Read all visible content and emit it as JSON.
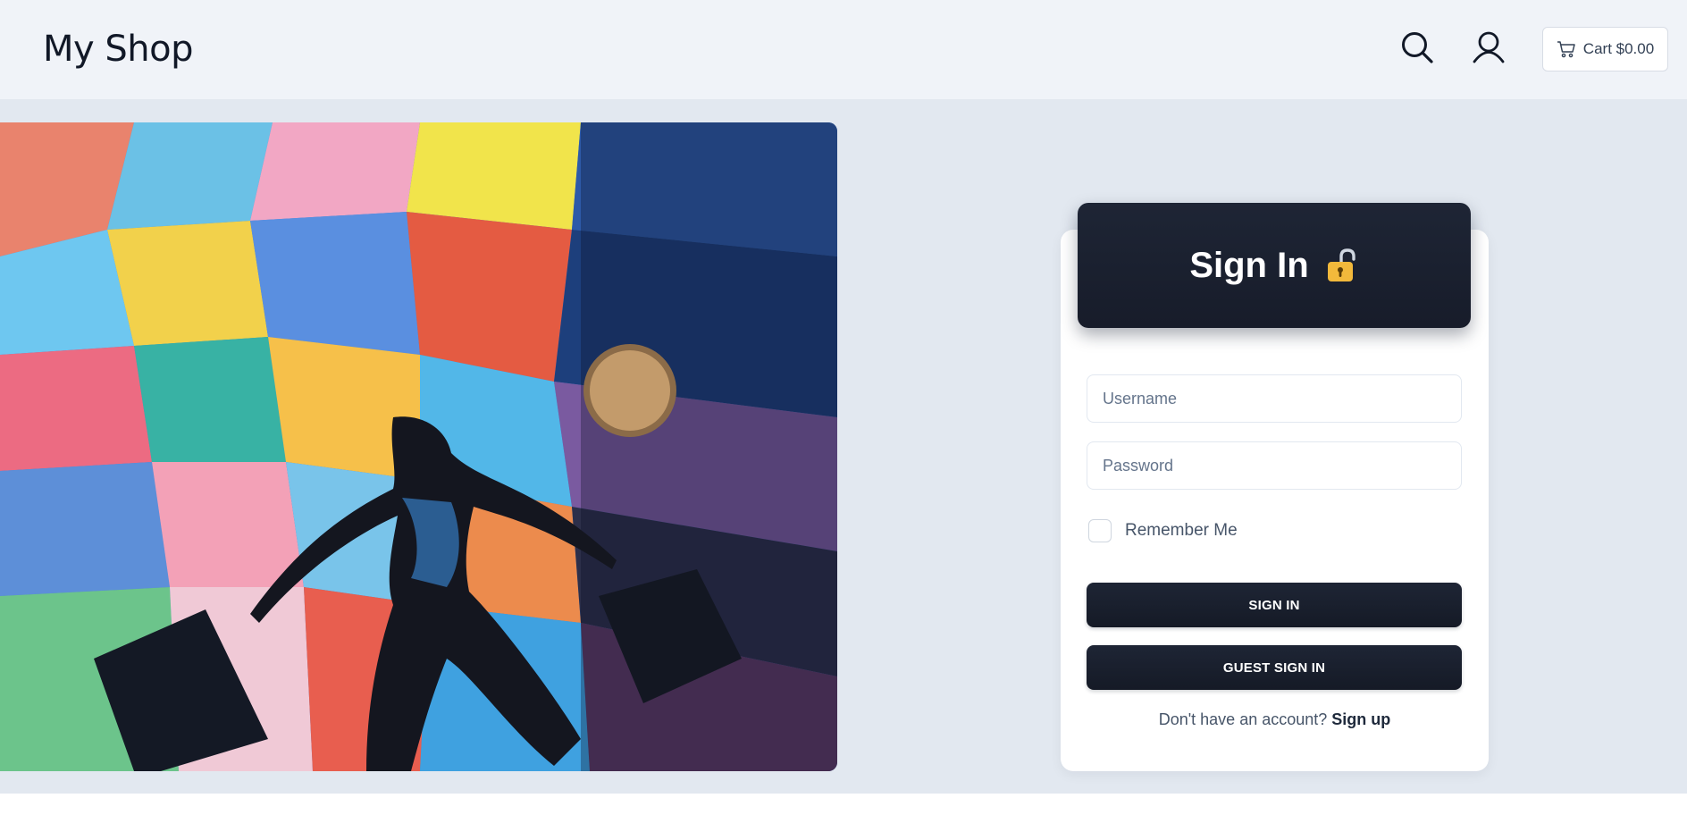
{
  "header": {
    "brand": "My Shop",
    "search_icon": "search-icon",
    "user_icon": "user-icon",
    "cart_icon": "cart-icon",
    "cart_label": "Cart $0.00"
  },
  "hero": {
    "image": "colorful-mural-shopper-photo"
  },
  "signin": {
    "title": "Sign In",
    "title_icon": "open-lock-icon",
    "username_placeholder": "Username",
    "password_placeholder": "Password",
    "remember_label": "Remember Me",
    "signin_button": "SIGN IN",
    "guest_button": "GUEST SIGN IN",
    "signup_prompt": "Don't have an account?",
    "signup_link": "Sign up"
  },
  "colors": {
    "header_bg": "#f0f3f8",
    "page_bg": "#e2e8f0",
    "dark": "#1e2535",
    "lock": "#f2b93b"
  }
}
